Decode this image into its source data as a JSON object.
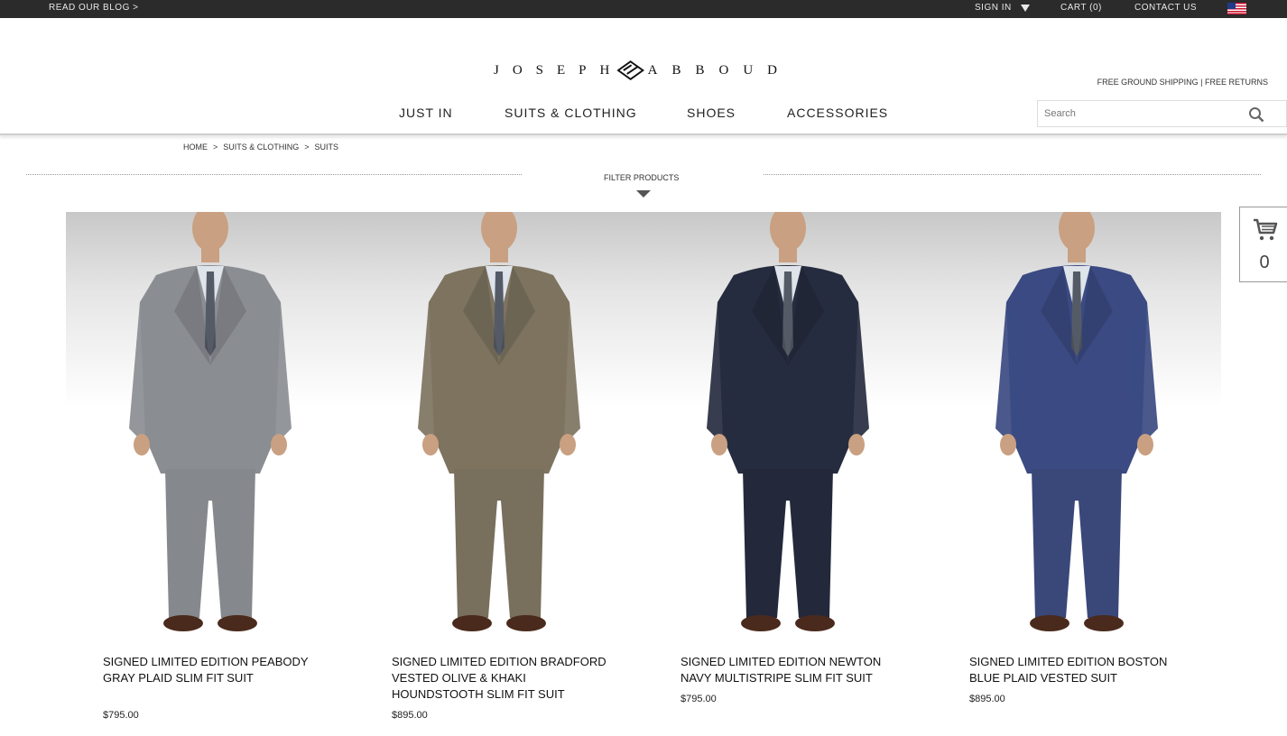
{
  "topbar": {
    "blog": "READ OUR BLOG >",
    "signin": "SIGN IN",
    "cart": "CART (0)",
    "contact": "CONTACT US",
    "flag_icon": "us-flag-icon"
  },
  "header": {
    "logo_left": "JOSEPH",
    "logo_right": "ABBOUD",
    "shipping": "FREE GROUND SHIPPING | FREE RETURNS"
  },
  "nav": [
    "JUST IN",
    "SUITS & CLOTHING",
    "SHOES",
    "ACCESSORIES"
  ],
  "search": {
    "placeholder": "Search",
    "icon": "search-icon"
  },
  "breadcrumb": [
    "HOME",
    "SUITS & CLOTHING",
    "SUITS"
  ],
  "breadcrumb_sep": ">",
  "filter": {
    "label": "FILTER PRODUCTS"
  },
  "products": [
    {
      "title": "SIGNED LIMITED EDITION PEABODY GRAY PLAID SLIM FIT SUIT",
      "price": "$795.00",
      "suit_color": "#8a8d92",
      "pant_color": "#85888c"
    },
    {
      "title": "SIGNED LIMITED EDITION BRADFORD VESTED OLIVE & KHAKI HOUNDSTOOTH SLIM FIT SUIT",
      "price": "$895.00",
      "suit_color": "#7d735f",
      "pant_color": "#786f5c"
    },
    {
      "title": "SIGNED LIMITED EDITION NEWTON NAVY MULTISTRIPE SLIM FIT SUIT",
      "price": "$795.00",
      "suit_color": "#262c3f",
      "pant_color": "#23293b"
    },
    {
      "title": "SIGNED LIMITED EDITION BOSTON BLUE PLAID VESTED SUIT",
      "price": "$895.00",
      "suit_color": "#3b4a82",
      "pant_color": "#394779"
    }
  ],
  "floating_cart": {
    "count": "0",
    "icon": "shopping-cart-icon"
  }
}
